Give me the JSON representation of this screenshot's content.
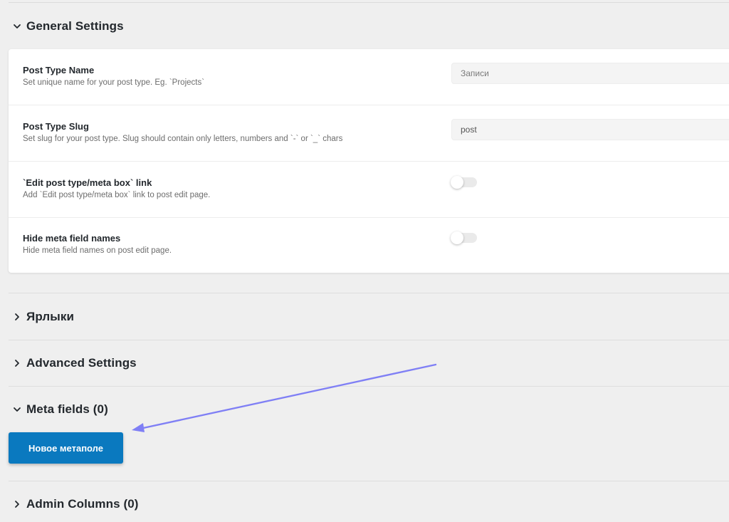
{
  "sections": {
    "general": {
      "title": "General Settings",
      "expanded": true
    },
    "labels": {
      "title": "Ярлыки",
      "expanded": false
    },
    "advanced": {
      "title": "Advanced Settings",
      "expanded": false
    },
    "meta_fields": {
      "title": "Meta fields (0)",
      "expanded": true
    },
    "admin_columns": {
      "title": "Admin Columns (0)",
      "expanded": false
    }
  },
  "general_settings": {
    "post_type_name": {
      "label": "Post Type Name",
      "description": "Set unique name for your post type. Eg. `Projects`",
      "placeholder": "Записи",
      "value": ""
    },
    "post_type_slug": {
      "label": "Post Type Slug",
      "description": "Set slug for your post type. Slug should contain only letters, numbers and `-` or `_` chars",
      "value": "post"
    },
    "edit_link": {
      "label": "`Edit post type/meta box` link",
      "description": "Add `Edit post type/meta box` link to post edit page.",
      "enabled": false
    },
    "hide_meta_names": {
      "label": "Hide meta field names",
      "description": "Hide meta field names on post edit page.",
      "enabled": false
    }
  },
  "meta_fields": {
    "new_button_label": "Новое метаполе"
  },
  "colors": {
    "accent": "#0a79bf",
    "annotation_arrow": "#7f7ff5",
    "page_background": "#efefef",
    "card_background": "#ffffff"
  },
  "icons": {
    "expanded": "chevron-down-icon",
    "collapsed": "chevron-right-icon"
  }
}
